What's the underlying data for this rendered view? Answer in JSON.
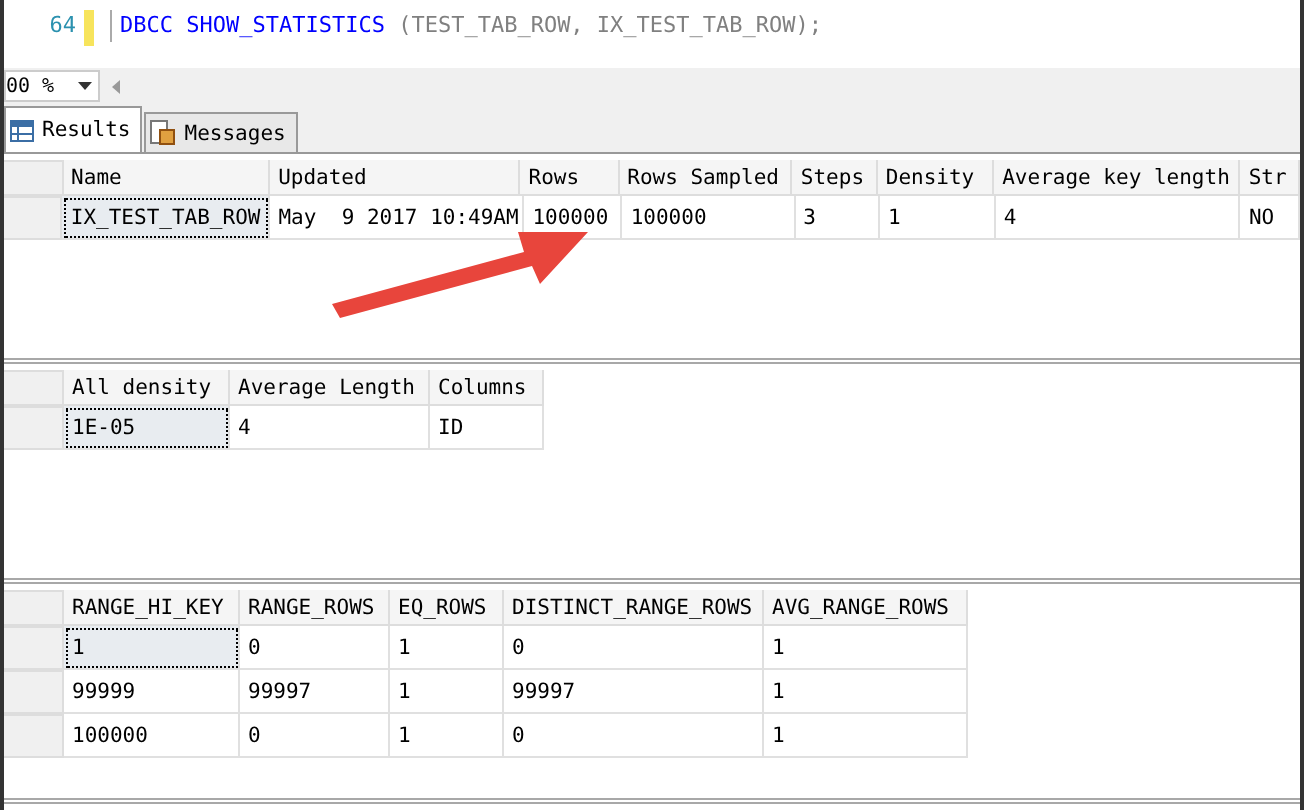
{
  "editor": {
    "line_number": "64",
    "tokens": [
      {
        "text": "DBCC",
        "kind": "keyword"
      },
      {
        "text": "SHOW_STATISTICS",
        "kind": "keyword"
      },
      {
        "text": "(TEST_TAB_ROW, IX_TEST_TAB_ROW);",
        "kind": "plain"
      }
    ]
  },
  "zoom": {
    "value": "00 %"
  },
  "tabs": [
    {
      "label": "Results",
      "selected": true,
      "kind": "grid"
    },
    {
      "label": "Messages",
      "selected": false,
      "kind": "messages"
    }
  ],
  "grids": [
    {
      "columns": [
        "Name",
        "Updated",
        "Rows",
        "Rows Sampled",
        "Steps",
        "Density",
        "Average key length",
        "Str"
      ],
      "rows": [
        {
          "focused": true,
          "cells": [
            "IX_TEST_TAB_ROW",
            "May  9 2017 10:49AM",
            "100000",
            "100000",
            "3",
            "1",
            "4",
            "NO"
          ]
        }
      ]
    },
    {
      "columns": [
        "All density",
        "Average Length",
        "Columns"
      ],
      "rows": [
        {
          "focused": true,
          "cells": [
            "1E-05",
            "4",
            "ID"
          ]
        }
      ]
    },
    {
      "columns": [
        "RANGE_HI_KEY",
        "RANGE_ROWS",
        "EQ_ROWS",
        "DISTINCT_RANGE_ROWS",
        "AVG_RANGE_ROWS"
      ],
      "rows": [
        {
          "focused": true,
          "cells": [
            "1",
            "0",
            "1",
            "0",
            "1"
          ]
        },
        {
          "focused": false,
          "cells": [
            "99999",
            "99997",
            "1",
            "99997",
            "1"
          ]
        },
        {
          "focused": false,
          "cells": [
            "100000",
            "0",
            "1",
            "0",
            "1"
          ]
        }
      ]
    }
  ]
}
